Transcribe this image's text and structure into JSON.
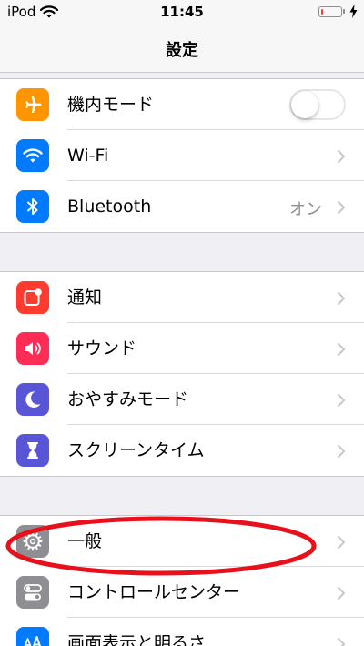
{
  "status_bar": {
    "carrier": "iPod",
    "time": "11:45",
    "battery_level": 0.12,
    "battery_color": "#ff3b30"
  },
  "nav": {
    "title": "設定"
  },
  "groups": [
    {
      "rows": [
        {
          "label": "機内モード",
          "icon": "airplane-icon",
          "icon_color": "#ff9500",
          "accessory": "toggle",
          "toggle_on": false
        },
        {
          "label": "Wi-Fi",
          "icon": "wifi-icon",
          "icon_color": "#007aff",
          "accessory": "chevron"
        },
        {
          "label": "Bluetooth",
          "icon": "bluetooth-icon",
          "icon_color": "#007aff",
          "value": "オン",
          "accessory": "chevron"
        }
      ]
    },
    {
      "rows": [
        {
          "label": "通知",
          "icon": "notifications-icon",
          "icon_color": "#ff3b30",
          "accessory": "chevron"
        },
        {
          "label": "サウンド",
          "icon": "speaker-icon",
          "icon_color": "#ff2d55",
          "accessory": "chevron"
        },
        {
          "label": "おやすみモード",
          "icon": "moon-icon",
          "icon_color": "#5856d6",
          "accessory": "chevron"
        },
        {
          "label": "スクリーンタイム",
          "icon": "hourglass-icon",
          "icon_color": "#5856d6",
          "accessory": "chevron"
        }
      ]
    },
    {
      "rows": [
        {
          "label": "一般",
          "icon": "gear-icon",
          "icon_color": "#8e8e93",
          "accessory": "chevron",
          "highlighted": true
        },
        {
          "label": "コントロールセンター",
          "icon": "switches-icon",
          "icon_color": "#8e8e93",
          "accessory": "chevron"
        },
        {
          "label": "画面表示と明るさ",
          "icon": "text-size-icon",
          "icon_color": "#007aff",
          "accessory": "chevron"
        }
      ]
    }
  ],
  "colors": {
    "highlight": "#e8101a",
    "chevron": "#c7c7cc"
  }
}
